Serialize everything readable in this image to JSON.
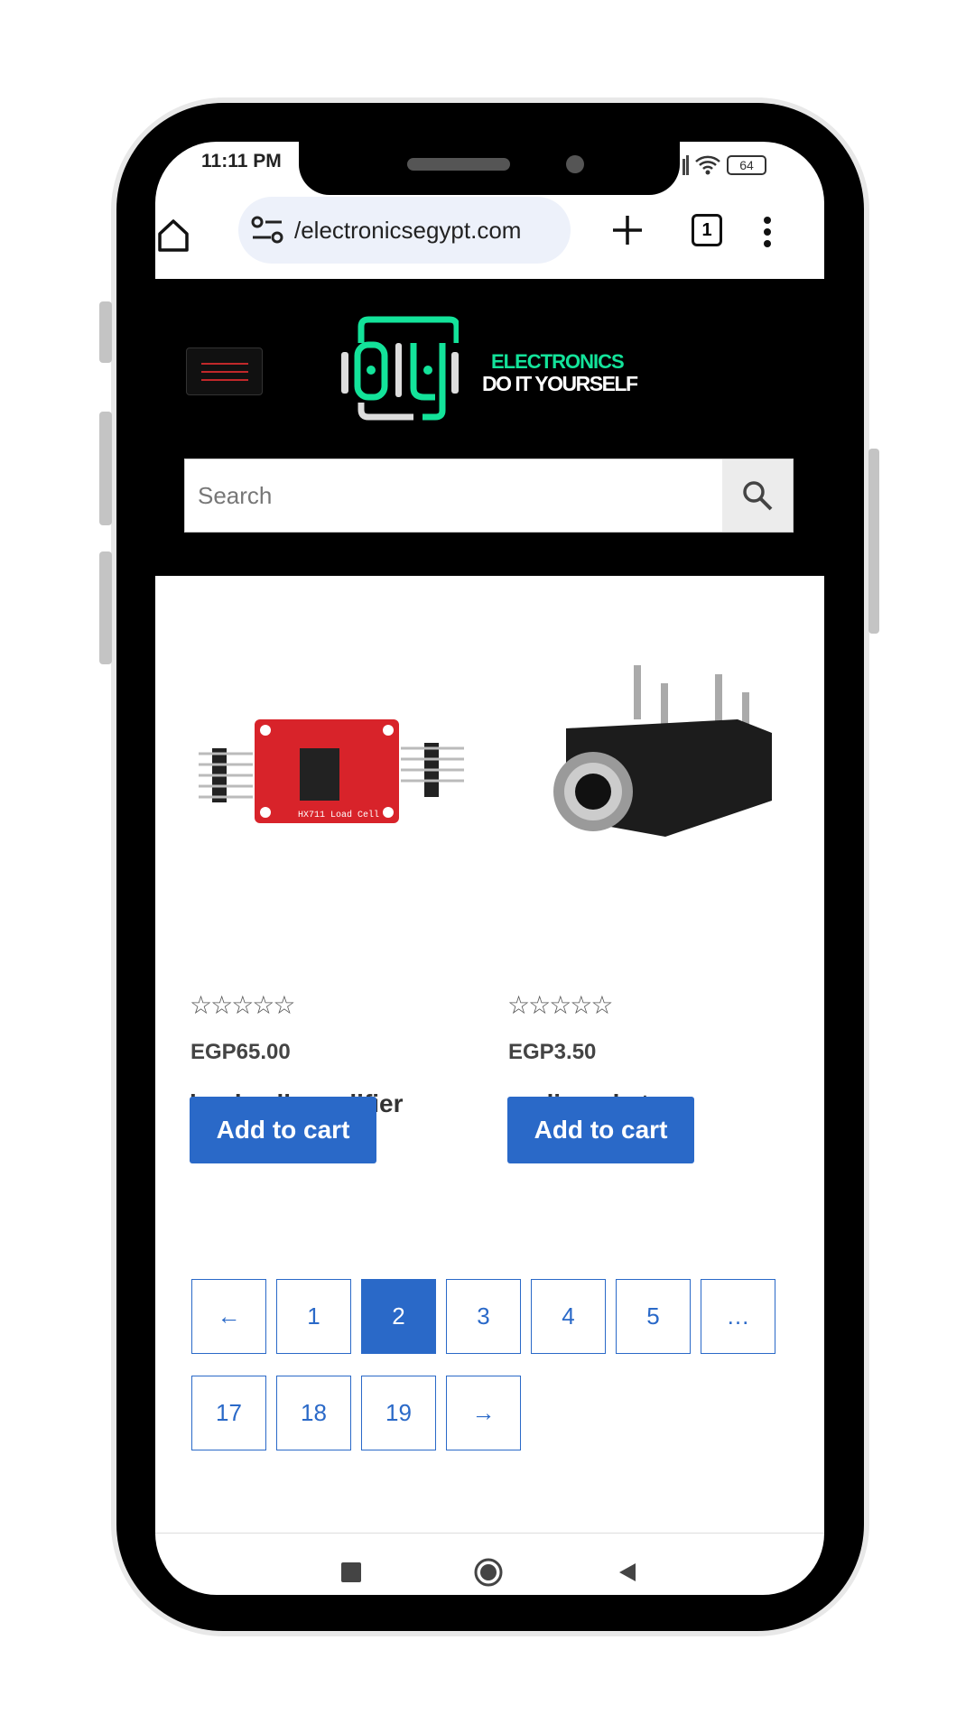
{
  "status": {
    "time": "11:11 PM",
    "battery": "64"
  },
  "browser": {
    "url": "/electronicsegypt.com",
    "tab_count": "1"
  },
  "site": {
    "logo_line1": "ELECTRONICS",
    "logo_line2": "DO IT YOURSELF",
    "logo_mark": "DIY",
    "search_placeholder": "Search"
  },
  "products": [
    {
      "title": "load cell amplifier",
      "rating": 0,
      "stars": "☆☆☆☆☆",
      "price": "EGP65.00",
      "button": "Add to cart",
      "image_label": "HX711 Load Cell"
    },
    {
      "title": "oudio soket",
      "rating": 0,
      "stars": "☆☆☆☆☆",
      "price": "EGP3.50",
      "button": "Add to cart"
    }
  ],
  "pagination": {
    "row1": [
      "←",
      "1",
      "2",
      "3",
      "4",
      "5",
      "…"
    ],
    "row2": [
      "17",
      "18",
      "19",
      "→"
    ],
    "current": "2"
  },
  "colors": {
    "accent": "#2a69c8",
    "logo_green": "#13e39a",
    "header_bg": "#000000",
    "menu_red": "#c0282a"
  }
}
